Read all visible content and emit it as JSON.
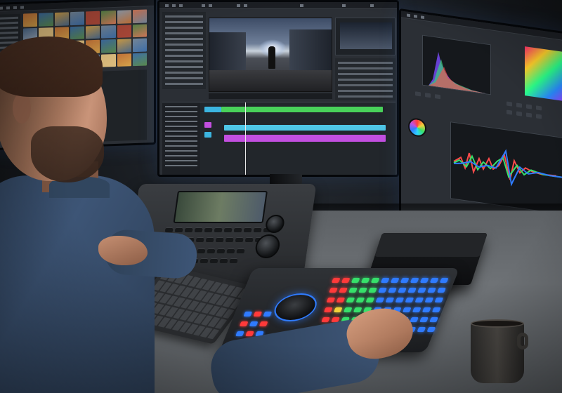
{
  "scene": {
    "subject": "video-editor-workstation",
    "accent_colors": {
      "clip_green": "#49d25a",
      "clip_cyan": "#4fc6e6",
      "clip_magenta": "#c34fe0",
      "led_blue": "#2f7bff",
      "led_green": "#36e06a",
      "led_red": "#ff3a3a",
      "led_yellow": "#f2d13a",
      "shirt": "#3d5576",
      "desk": "#6e7276"
    },
    "icons": [
      "color-wheel-icon",
      "jog-wheel-icon",
      "coffee-mug-icon"
    ]
  }
}
